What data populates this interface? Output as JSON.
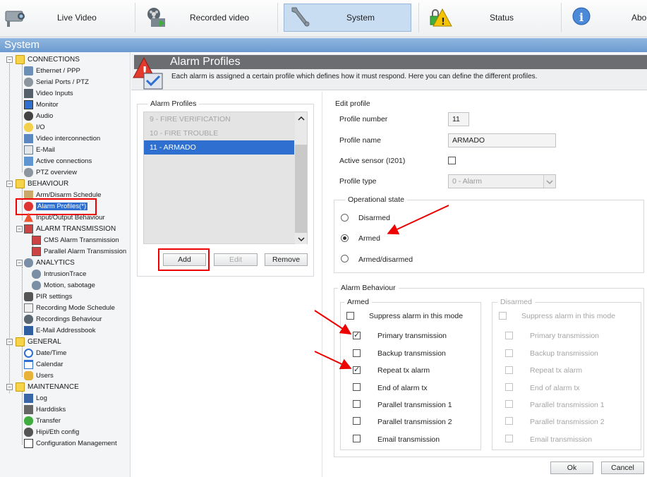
{
  "topnav": {
    "tabs": [
      {
        "label": "Live Video"
      },
      {
        "label": "Recorded video"
      },
      {
        "label": "System"
      },
      {
        "label": "Status"
      },
      {
        "label": "About"
      }
    ]
  },
  "section_title": "System",
  "sidebar": {
    "groups": [
      {
        "label": "CONNECTIONS",
        "items": [
          "Ethernet / PPP",
          "Serial Ports / PTZ",
          "Video Inputs",
          "Monitor",
          "Audio",
          "I/O",
          "Video interconnection",
          "E-Mail",
          "Active connections",
          "PTZ overview"
        ]
      },
      {
        "label": "BEHAVIOUR",
        "items": [
          "Arm/Disarm Schedule",
          "Alarm Profiles(*)",
          "Input/Output Behaviour"
        ]
      },
      {
        "label": "ALARM TRANSMISSION",
        "items": [
          "CMS Alarm Transmission",
          "Parallel Alarm Transmission"
        ]
      },
      {
        "label": "ANALYTICS",
        "items": [
          "IntrusionTrace",
          "Motion, sabotage"
        ]
      },
      {
        "label": "",
        "items": [
          "PIR settings",
          "Recording Mode Schedule",
          "Recordings Behaviour",
          "E-Mail Addressbook"
        ]
      },
      {
        "label": "GENERAL",
        "items": [
          "Date/Time",
          "Calendar",
          "Users"
        ]
      },
      {
        "label": "MAINTENANCE",
        "items": [
          "Log",
          "Harddisks",
          "Transfer",
          "Hipi/Eth config",
          "Configuration Management"
        ]
      }
    ]
  },
  "header": {
    "title": "Alarm Profiles",
    "description": "Each alarm is assigned a certain profile which defines how it must respond. Here you can define the different profiles."
  },
  "profiles_panel": {
    "legend": "Alarm Profiles",
    "items": [
      "9 - FIRE VERIFICATION",
      "10 - FIRE TROUBLE",
      "11 - ARMADO"
    ],
    "selected_index": 2,
    "add_label": "Add",
    "edit_label": "Edit",
    "remove_label": "Remove"
  },
  "edit_profile": {
    "legend": "Edit profile",
    "profile_number_label": "Profile number",
    "profile_number": "11",
    "profile_name_label": "Profile name",
    "profile_name": "ARMADO",
    "active_sensor_label": "Active sensor (I201)",
    "profile_type_label": "Profile type",
    "profile_type": "0 - Alarm"
  },
  "operational_state": {
    "legend": "Operational state",
    "options": [
      "Disarmed",
      "Armed",
      "Armed/disarmed"
    ],
    "selected": "Armed"
  },
  "alarm_behaviour": {
    "legend": "Alarm Behaviour",
    "armed_legend": "Armed",
    "disarmed_legend": "Disarmed",
    "suppress_label": "Suppress alarm in this mode",
    "items": [
      "Primary transmission",
      "Backup transmission",
      "Repeat tx alarm",
      "End of alarm tx",
      "Parallel transmission 1",
      "Parallel transmission 2",
      "Email transmission"
    ],
    "armed_checked": [
      true,
      false,
      true,
      false,
      false,
      false,
      false
    ]
  },
  "footer": {
    "ok_label": "Ok",
    "cancel_label": "Cancel"
  },
  "colors": {
    "accent_blue": "#2f6fd0",
    "annotation_red": "#e00000",
    "title_bar": "#7aa6d6"
  }
}
